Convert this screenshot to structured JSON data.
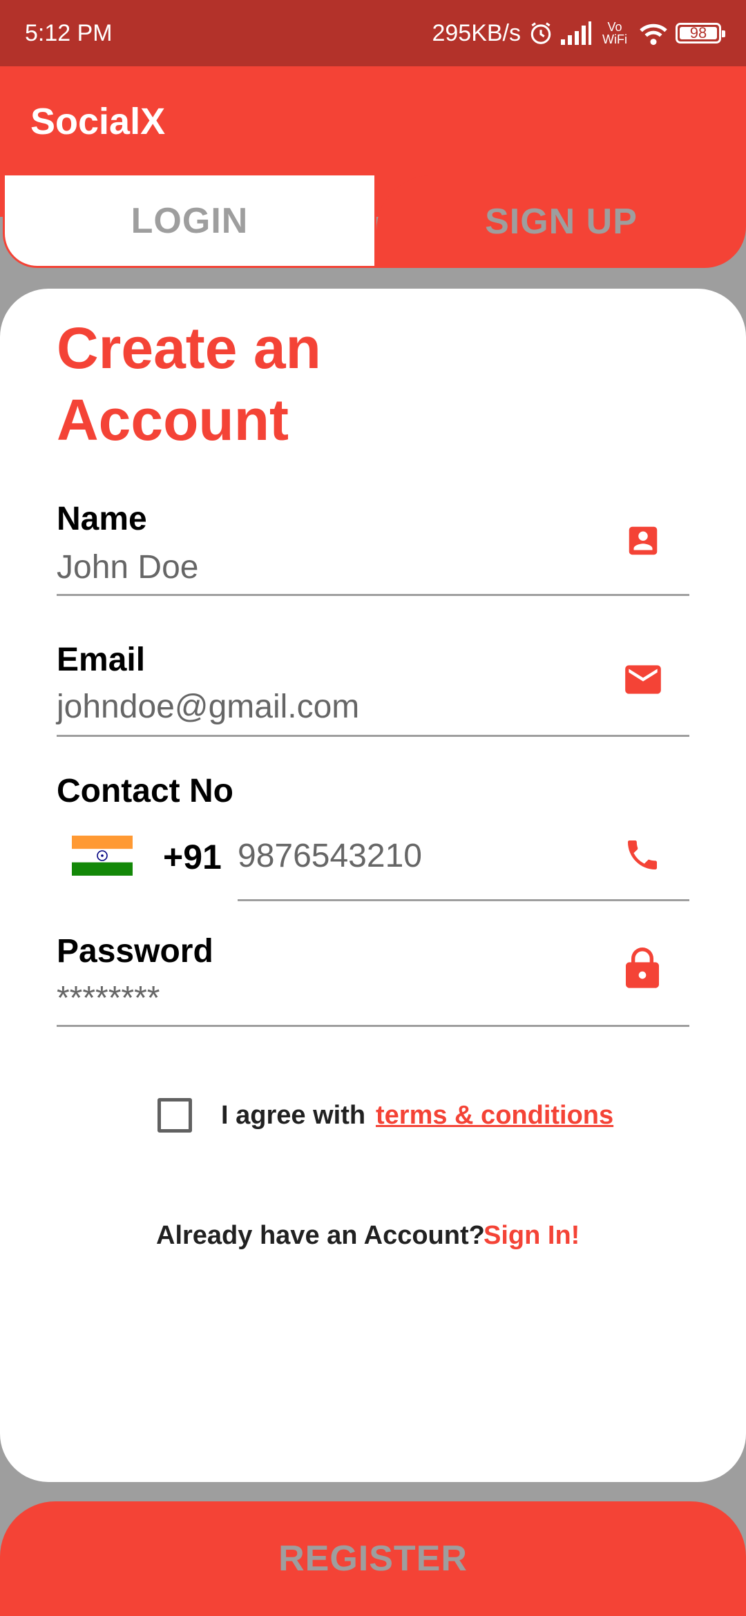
{
  "status_bar": {
    "time": "5:12 PM",
    "net_speed": "295KB/s",
    "volte": "Vo WiFi",
    "battery": "98"
  },
  "app": {
    "title": "SocialX"
  },
  "tabs": [
    {
      "label": "LOGIN"
    },
    {
      "label": "SIGN UP"
    }
  ],
  "form": {
    "title": "Create an Account",
    "name": {
      "label": "Name",
      "value": "John Doe",
      "icon": "account-box-icon"
    },
    "email": {
      "label": "Email",
      "value": "johndoe@gmail.com",
      "icon": "mail-icon"
    },
    "contact": {
      "label": "Contact No",
      "country_code": "+91",
      "value": "9876543210",
      "icon": "phone-icon",
      "flag": "india-flag-icon"
    },
    "password": {
      "label": "Password",
      "value": "********",
      "icon": "lock-icon"
    },
    "agree_text": "I agree with",
    "terms_link": "terms & conditions",
    "already_text": "Already have an Account?",
    "signin_link": "Sign In!"
  },
  "register_label": "REGISTER",
  "colors": {
    "accent": "#f44336",
    "status_bar": "#b3322a",
    "background": "#9e9e9e"
  }
}
